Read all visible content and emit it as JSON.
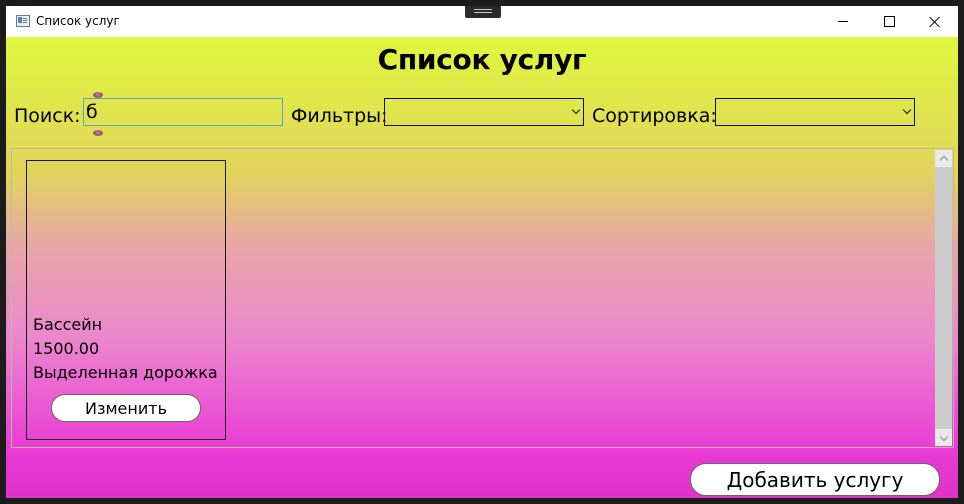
{
  "window": {
    "title": "Список услуг",
    "icon": "app-window-icon",
    "controls": [
      "minimize-icon",
      "maximize-icon",
      "close-icon"
    ]
  },
  "header": {
    "title": "Список услуг"
  },
  "toolbar": {
    "search_label": "Поиск:",
    "search_value": "б",
    "filter_label": "Фильтры:",
    "filter_value": "",
    "sort_label": "Сортировка:",
    "sort_value": ""
  },
  "services": [
    {
      "name": "Бассейн",
      "price": "1500.00",
      "description": "Выделенная дорожка",
      "edit_label": "Изменить"
    }
  ],
  "footer": {
    "add_label": "Добавить услугу"
  },
  "colors": {
    "gradient_top": "#e0f73c",
    "gradient_bottom": "#e032c8",
    "search_border": "#59a8c2"
  }
}
